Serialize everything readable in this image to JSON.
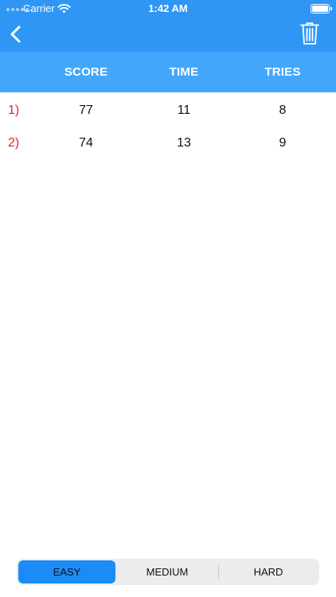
{
  "status_bar": {
    "carrier": "Carrier",
    "time": "1:42 AM"
  },
  "nav": {
    "back_icon": "chevron-left-icon",
    "trash_icon": "trash-icon"
  },
  "columns": {
    "score": "SCORE",
    "time": "TIME",
    "tries": "TRIES"
  },
  "rows": [
    {
      "rank": "1)",
      "score": "77",
      "time": "11",
      "tries": "8"
    },
    {
      "rank": "2)",
      "score": "74",
      "time": "13",
      "tries": "9"
    }
  ],
  "difficulty": {
    "options": [
      "EASY",
      "MEDIUM",
      "HARD"
    ],
    "selected": "EASY"
  },
  "colors": {
    "nav_bar": "#2f96f5",
    "header_row": "#42a7fb",
    "rank_text": "#e3271e",
    "selected_segment": "#1b8cf7"
  }
}
